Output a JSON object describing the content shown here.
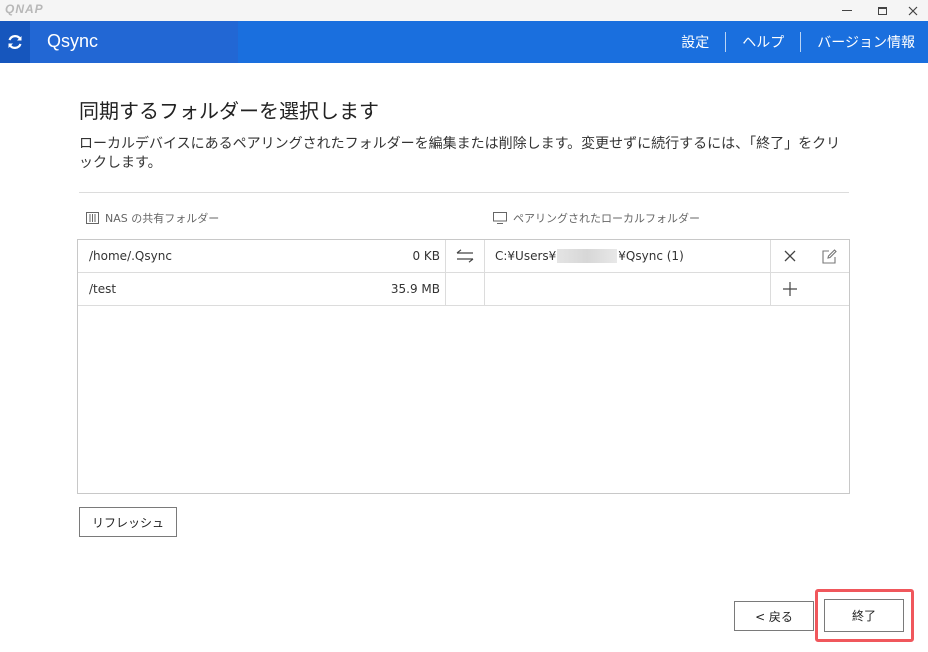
{
  "window": {
    "brand": "QNAP",
    "minimize": "—",
    "maximize": "□",
    "close": "✕"
  },
  "header": {
    "app_name": "Qsync",
    "nav": [
      "設定",
      "ヘルプ",
      "バージョン情報"
    ]
  },
  "page": {
    "title": "同期するフォルダーを選択します",
    "description": "ローカルデバイスにあるペアリングされたフォルダーを編集または削除します。変更せずに続行するには、「終了」をクリックします。"
  },
  "columns": {
    "nas": "NAS の共有フォルダー",
    "local": "ペアリングされたローカルフォルダー"
  },
  "rows": [
    {
      "nas_path": "/home/.Qsync",
      "size": "0 KB",
      "local_prefix": "C:¥Users¥",
      "local_suffix": "¥Qsync (1)"
    },
    {
      "nas_path": "/test",
      "size": "35.9 MB",
      "local_prefix": "",
      "local_suffix": ""
    }
  ],
  "buttons": {
    "refresh": "リフレッシュ",
    "back": "< 戻る",
    "finish": "終了"
  },
  "colors": {
    "header_blue": "#1a6fde",
    "highlight_red": "#f0575c"
  }
}
